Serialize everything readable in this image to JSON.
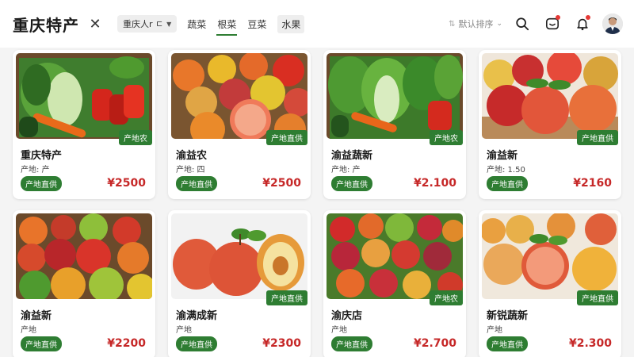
{
  "header": {
    "title": "重庆特产",
    "close_icon": "close-icon",
    "city_select": {
      "value": "重庆人r ㄷ",
      "icon": "chevron-down-icon"
    },
    "tabs": [
      {
        "label": "蔬菜",
        "active": false
      },
      {
        "label": "根菜",
        "active": true
      },
      {
        "label": "豆菜",
        "active": false
      },
      {
        "label": "水果",
        "active": false
      }
    ],
    "sort_select": {
      "value": "默认排序",
      "icon": "chevron-down-icon"
    },
    "icons": {
      "search": "search-icon",
      "message": "message-icon",
      "bell": "bell-icon",
      "avatar": "avatar"
    }
  },
  "colors": {
    "accent_green": "#2e7d32",
    "price_red": "#c62828",
    "notification_red": "#e53935"
  },
  "products": [
    {
      "name": "重庆特产",
      "origin": "产地: 产",
      "origin_badge": "产地直供",
      "image_badge": "产地农",
      "price": "¥2500",
      "image": "mixed-vegetables"
    },
    {
      "name": "渝益农",
      "origin": "产地: 四",
      "origin_badge": "产地直供",
      "image_badge": "产地直供",
      "price": "¥2500",
      "image": "apples-and-grapefruit"
    },
    {
      "name": "渝益蔬新",
      "origin": "产地: 产",
      "origin_badge": "产地直供",
      "image_badge": "产地农",
      "price": "¥2.100",
      "image": "leafy-greens"
    },
    {
      "name": "渝益新",
      "origin": "产地: 1.50",
      "origin_badge": "产地直供",
      "image_badge": "产地直供",
      "price": "¥2160",
      "image": "red-apples"
    },
    {
      "name": "渝益新",
      "origin": "产地",
      "origin_badge": "产地直供",
      "image_badge": "",
      "price": "¥2200",
      "image": "assorted-fruit"
    },
    {
      "name": "渝满成新",
      "origin": "产地",
      "origin_badge": "产地直供",
      "image_badge": "产地直供",
      "price": "¥2300",
      "image": "apples-cut"
    },
    {
      "name": "渝庆店",
      "origin": "产地",
      "origin_badge": "产地直供",
      "image_badge": "产地农",
      "price": "¥2.700",
      "image": "apples-plums"
    },
    {
      "name": "新锐蔬新",
      "origin": "产地",
      "origin_badge": "产地直供",
      "image_badge": "产地直供",
      "price": "¥2.300",
      "image": "peaches-grapefruit"
    }
  ]
}
